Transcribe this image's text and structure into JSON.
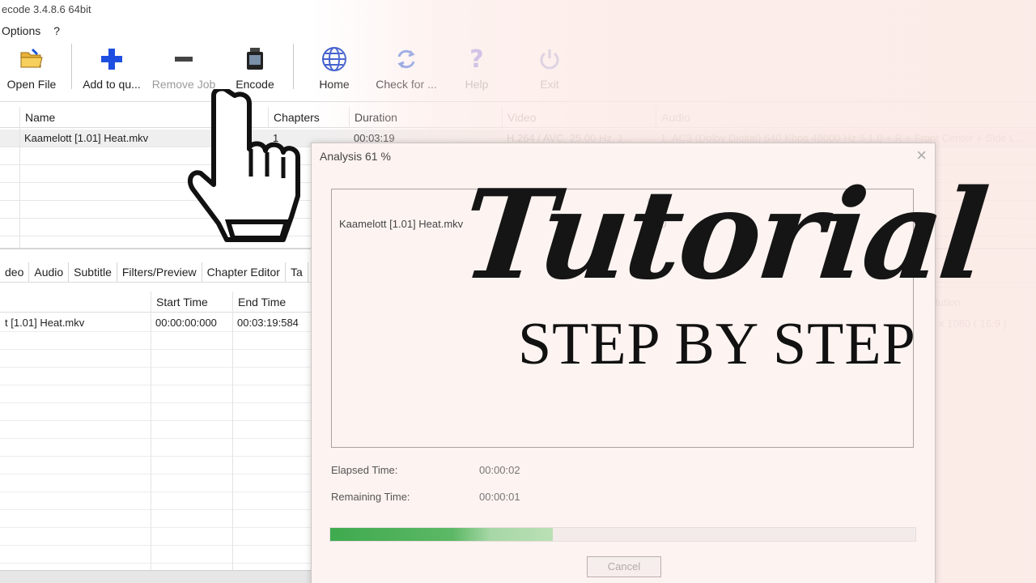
{
  "window": {
    "title": "ecode 3.4.8.6 64bit"
  },
  "menu": {
    "items": [
      "Options",
      "?"
    ]
  },
  "toolbar": {
    "open_file": "Open File",
    "add_to_queue": "Add to qu...",
    "remove_job": "Remove Job",
    "encode": "Encode",
    "home": "Home",
    "check_for": "Check for ...",
    "help": "Help",
    "exit": "Exit"
  },
  "file_grid": {
    "columns": [
      "Name",
      "Chapters",
      "Duration",
      "Video",
      "Audio"
    ],
    "rows": [
      {
        "name": "Kaamelott [1.01] Heat.mkv",
        "chapters": "1",
        "duration": "00:03:19",
        "video": "H.264 / AVC, 25.00 Hz, 1...",
        "audio": "1. AC3 (Dolby Digital) 640 Kbps 48000 Hz 5.1.0 + R + Front Center + Side L..."
      }
    ]
  },
  "tabs": [
    "deo",
    "Audio",
    "Subtitle",
    "Filters/Preview",
    "Chapter Editor",
    "Ta"
  ],
  "sub_grid": {
    "columns": [
      "Start Time",
      "End Time"
    ],
    "rows": [
      {
        "name": "t [1.01] Heat.mkv",
        "start": "00:00:00:000",
        "end": "00:03:19:584"
      }
    ]
  },
  "right_panel": {
    "resolution_label": "lution",
    "resolution_value": "x 1080 ( 16:9 )"
  },
  "dialog": {
    "title": "Analysis 61 %",
    "close": "×",
    "pct_header": "%",
    "file": "Kaamelott [1.01] Heat.mkv",
    "pct": "61.0",
    "elapsed_label": "Elapsed Time:",
    "elapsed_value": "00:00:02",
    "remaining_label": "Remaining Time:",
    "remaining_value": "00:00:01",
    "progress_percent": 38,
    "cancel": "Cancel"
  },
  "overlay": {
    "title": "Tutorial",
    "subtitle": "STEP BY STEP"
  },
  "colors": {
    "progress": "#3faa4f",
    "veil": "#fcece8",
    "add_icon": "#1f4fe0",
    "globe": "#3355cc"
  }
}
